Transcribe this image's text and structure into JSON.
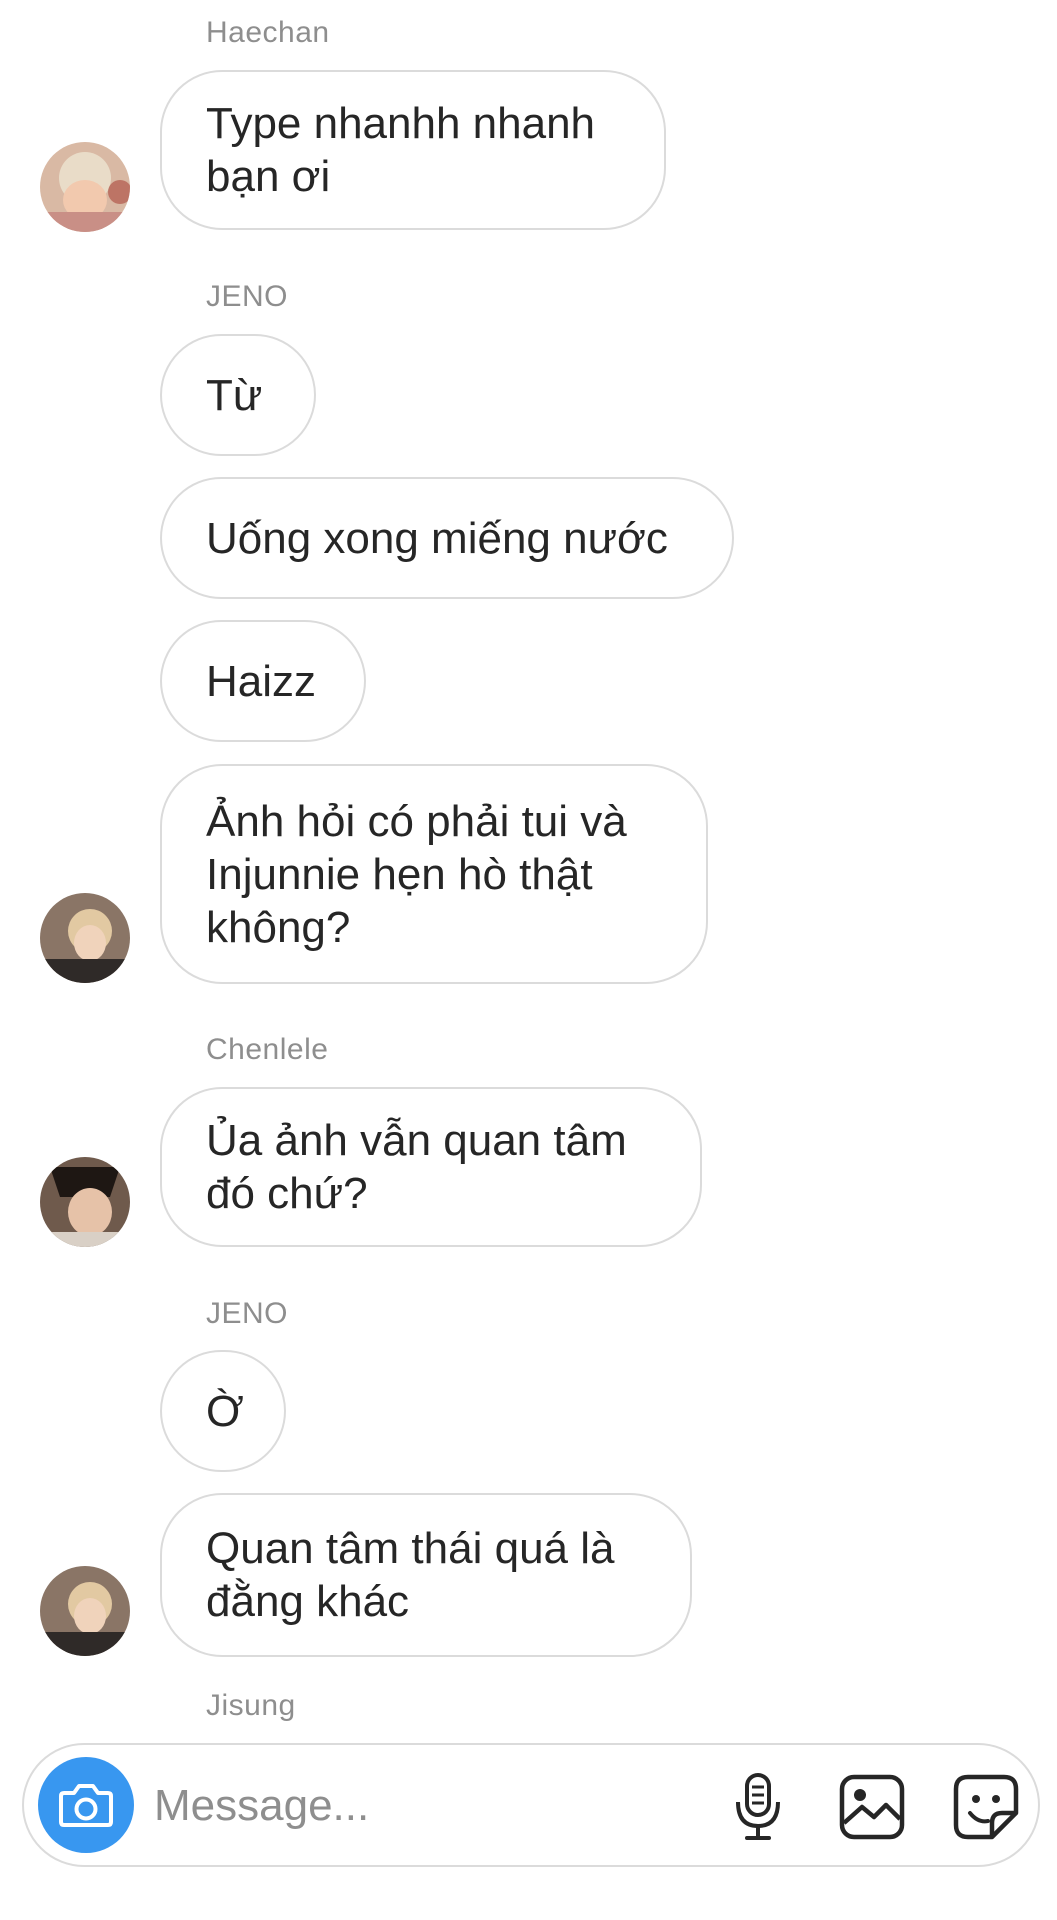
{
  "thread": {
    "groups": [
      {
        "sender": "Haechan",
        "messages": [
          "Type nhanhh nhanh\nbạn ơi"
        ]
      },
      {
        "sender": "JENO",
        "messages": [
          "Từ",
          "Uống xong miếng nước",
          "Haizz",
          "Ảnh hỏi có phải tui và\nInjunnie hẹn hò thật\nkhông?"
        ]
      },
      {
        "sender": "Chenlele",
        "messages": [
          "Ủa ảnh vẫn quan tâm\nđó chứ?"
        ]
      },
      {
        "sender": "JENO",
        "messages": [
          "Ờ",
          "Quan tâm thái quá là\nđằng khác"
        ]
      },
      {
        "sender": "Jisung",
        "messages": []
      }
    ]
  },
  "composer": {
    "placeholder": "Message...",
    "icons": [
      "camera-icon",
      "microphone-icon",
      "gallery-icon",
      "sticker-icon"
    ],
    "accent_color": "#3897f0"
  }
}
